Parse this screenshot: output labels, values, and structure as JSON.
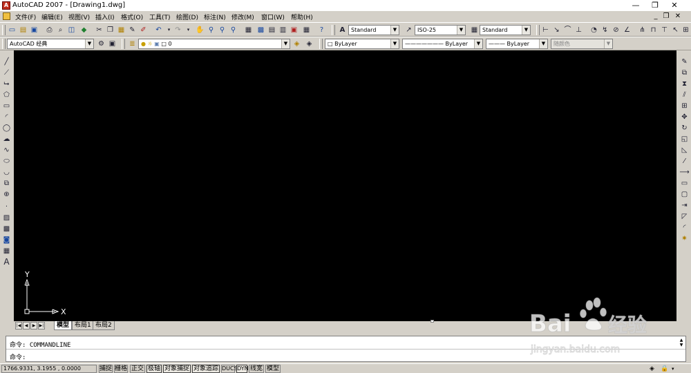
{
  "window": {
    "title": "AutoCAD 2007 - [Drawing1.dwg]",
    "app_icon_text": "A",
    "minimize": "—",
    "restore": "❐",
    "close": "✕"
  },
  "menu": [
    "文件(F)",
    "编辑(E)",
    "视图(V)",
    "插入(I)",
    "格式(O)",
    "工具(T)",
    "绘图(D)",
    "标注(N)",
    "修改(M)",
    "窗口(W)",
    "帮助(H)"
  ],
  "toolbar_styles": {
    "text_style": "Standard",
    "dim_style": "ISO-25",
    "table_style": "Standard"
  },
  "toolbar_layers": {
    "workspace": "AutoCAD 经典",
    "layer": "0",
    "color": "ByLayer",
    "linetype": "ByLayer",
    "lineweight": "ByLayer",
    "plot_style": "随颜色"
  },
  "ucs": {
    "y_label": "Y",
    "x_label": "X"
  },
  "layout_tabs": [
    "模型",
    "布局1",
    "布局2"
  ],
  "command": {
    "history_line": "命令: COMMANDLINE",
    "prompt_line": "命令:"
  },
  "status": {
    "coordinates": "1766.9331, 3.1955 , 0.0000",
    "buttons": [
      "捕捉",
      "栅格",
      "正交",
      "极轴",
      "对象捕捉",
      "对象追踪",
      "DUCS",
      "DYN",
      "线宽",
      "模型"
    ]
  },
  "watermark": {
    "brand": "Bai",
    "brand_suffix": "经验",
    "url": "jingyan.baidu.com"
  },
  "colors": {
    "canvas": "#000000",
    "chrome": "#d4d0c8",
    "accent": "#1848a0"
  }
}
